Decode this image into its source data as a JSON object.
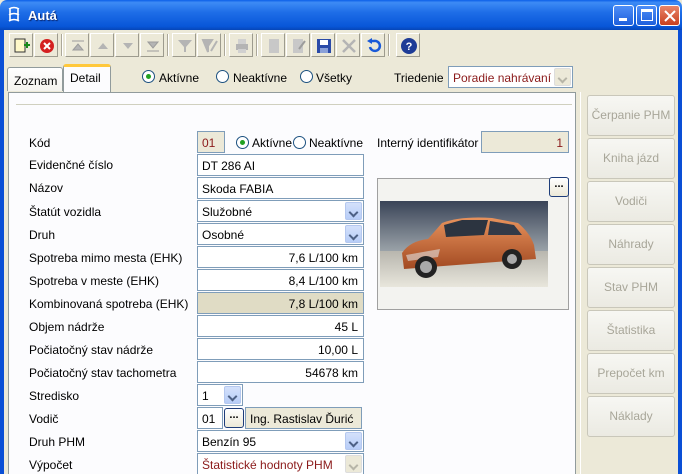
{
  "window": {
    "title": "Autá"
  },
  "tabs": [
    {
      "label": "Zoznam"
    },
    {
      "label": "Detail"
    }
  ],
  "filter": {
    "options": [
      "Aktívne",
      "Neaktívne",
      "Všetky"
    ],
    "selected": "Aktívne",
    "sort_label": "Triedenie",
    "sort_value": "Poradie nahrávaní"
  },
  "form": {
    "kod": {
      "label": "Kód",
      "value": "01"
    },
    "status_radio": {
      "active": "Aktívne",
      "inactive": "Neaktívne",
      "selected": "Aktívne"
    },
    "internal_id": {
      "label": "Interný identifikátor",
      "value": "1"
    },
    "evc": {
      "label": "Evidenčné číslo",
      "value": "DT 286 AI"
    },
    "nazov": {
      "label": "Názov",
      "value": "Skoda FABIA"
    },
    "statut": {
      "label": "Štatút vozidla",
      "value": "Služobné"
    },
    "druh": {
      "label": "Druh",
      "value": "Osobné"
    },
    "spotreba_mimo": {
      "label": "Spotreba mimo mesta (EHK)",
      "value": "7,6 L/100 km"
    },
    "spotreba_meste": {
      "label": "Spotreba v meste (EHK)",
      "value": "8,4 L/100 km"
    },
    "spotreba_komb": {
      "label": "Kombinovaná spotreba (EHK)",
      "value": "7,8 L/100 km"
    },
    "objem": {
      "label": "Objem nádrže",
      "value": "45 L"
    },
    "poc_nadrz": {
      "label": "Počiatočný stav nádrže",
      "value": "10,00 L"
    },
    "poc_tacho": {
      "label": "Počiatočný stav tachometra",
      "value": "54678 km"
    },
    "stredisko": {
      "label": "Stredisko",
      "value": "1"
    },
    "vodic": {
      "label": "Vodič",
      "code": "01",
      "name": "Ing. Rastislav Ďurić"
    },
    "druh_phm": {
      "label": "Druh PHM",
      "value": "Benzín 95"
    },
    "vypocet": {
      "label": "Výpočet",
      "value": "Štatistické hodnoty PHM"
    }
  },
  "side_buttons": [
    "Čerpanie PHM",
    "Kniha jázd",
    "Vodiči",
    "Náhrady",
    "Stav PHM",
    "Štatistika",
    "Prepočet km",
    "Náklady"
  ],
  "colors": {
    "titlebar": "#0a5fe8",
    "tab_accent": "#ffc83c",
    "highlight_field": "#e0dcc5",
    "code_text": "#8b1a1a"
  }
}
